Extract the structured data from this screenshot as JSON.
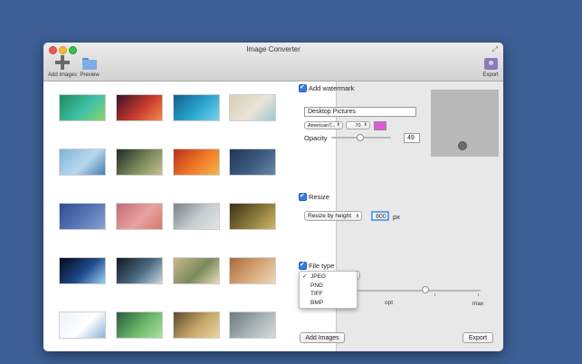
{
  "window": {
    "title": "Image Converter",
    "fullscreen_glyph": "⤢"
  },
  "toolbar": {
    "add_images_label": "Add Images",
    "preview_label": "Preview",
    "export_label": "Export"
  },
  "gallery": {
    "thumbnails": [
      {
        "name": "green-aerial",
        "colors": [
          "#1f8a5c",
          "#3ec1a8",
          "#8fd66a"
        ]
      },
      {
        "name": "red-canyon",
        "colors": [
          "#3a1226",
          "#c93a2c",
          "#f08a4a"
        ]
      },
      {
        "name": "blue-water",
        "colors": [
          "#0f5f8a",
          "#2aa6d0",
          "#7ad4ec"
        ]
      },
      {
        "name": "sand-beach",
        "colors": [
          "#d8cdb6",
          "#e9e4d8",
          "#9fc7cf"
        ]
      },
      {
        "name": "blue-ice",
        "colors": [
          "#7fb3d9",
          "#b8d8ef",
          "#4a7fb0"
        ]
      },
      {
        "name": "grass-dark",
        "colors": [
          "#1d2a24",
          "#7b8a5a",
          "#c8c090"
        ]
      },
      {
        "name": "autumn-leaves",
        "colors": [
          "#b8321a",
          "#f07a28",
          "#f2b64a"
        ]
      },
      {
        "name": "dark-blue-sky",
        "colors": [
          "#1e3552",
          "#3d5c82",
          "#6b88a8"
        ]
      },
      {
        "name": "blue-crevasse",
        "colors": [
          "#2d4d8a",
          "#5a78b8",
          "#8aa2d2"
        ]
      },
      {
        "name": "pink-dunes",
        "colors": [
          "#c46a7a",
          "#e8a2a0",
          "#d47a6a"
        ]
      },
      {
        "name": "foggy-lake",
        "colors": [
          "#7a8288",
          "#c8cdd0",
          "#e2e4e4"
        ]
      },
      {
        "name": "golden-forest",
        "colors": [
          "#3a3216",
          "#8a7a3a",
          "#d0b86a"
        ]
      },
      {
        "name": "earth-night",
        "colors": [
          "#050a1a",
          "#1e4a8a",
          "#9ad0f0"
        ]
      },
      {
        "name": "earth-orbit",
        "colors": [
          "#101820",
          "#4a6a80",
          "#c8d8e0"
        ]
      },
      {
        "name": "elephant-savanna",
        "colors": [
          "#c8b890",
          "#7a8a5a",
          "#e8dcb8"
        ]
      },
      {
        "name": "desert-caravan",
        "colors": [
          "#a86a3a",
          "#d8a87a",
          "#efd8b8"
        ]
      },
      {
        "name": "snow-field",
        "colors": [
          "#e8f2fa",
          "#ffffff",
          "#8ab4d8"
        ]
      },
      {
        "name": "lily-pads",
        "colors": [
          "#2a5a3a",
          "#6ab86a",
          "#aee0a0"
        ]
      },
      {
        "name": "desert-dunes",
        "colors": [
          "#5a4a2a",
          "#c8a86a",
          "#e8d4a0"
        ]
      },
      {
        "name": "misty-water",
        "colors": [
          "#6a7a80",
          "#a8b4b4",
          "#d8dcd8"
        ]
      }
    ]
  },
  "watermark": {
    "checkbox_label": "Add watermark",
    "checked": true,
    "text_value": "Desktop Pictures",
    "font_popup": "AmericanT...",
    "size_popup": "70",
    "color": "#e25ad9",
    "opacity_label": "Opacity",
    "opacity_value": "49",
    "opacity_level": 0.49
  },
  "resize": {
    "checkbox_label": "Resize",
    "checked": true,
    "mode_popup": "Resize by height",
    "value": "800",
    "unit": "px"
  },
  "filetype": {
    "checkbox_label": "File type",
    "checked": true,
    "menu_items": [
      {
        "label": "JPEG",
        "selected": true
      },
      {
        "label": "PNG",
        "selected": false
      },
      {
        "label": "TIFF",
        "selected": false
      },
      {
        "label": "BMP",
        "selected": false
      }
    ],
    "check_glyph": "✓",
    "quality_opt_label": "opt",
    "quality_max_label": "max",
    "quality_level": 0.55
  },
  "buttons": {
    "add_images": "Add Images",
    "export": "Export"
  }
}
